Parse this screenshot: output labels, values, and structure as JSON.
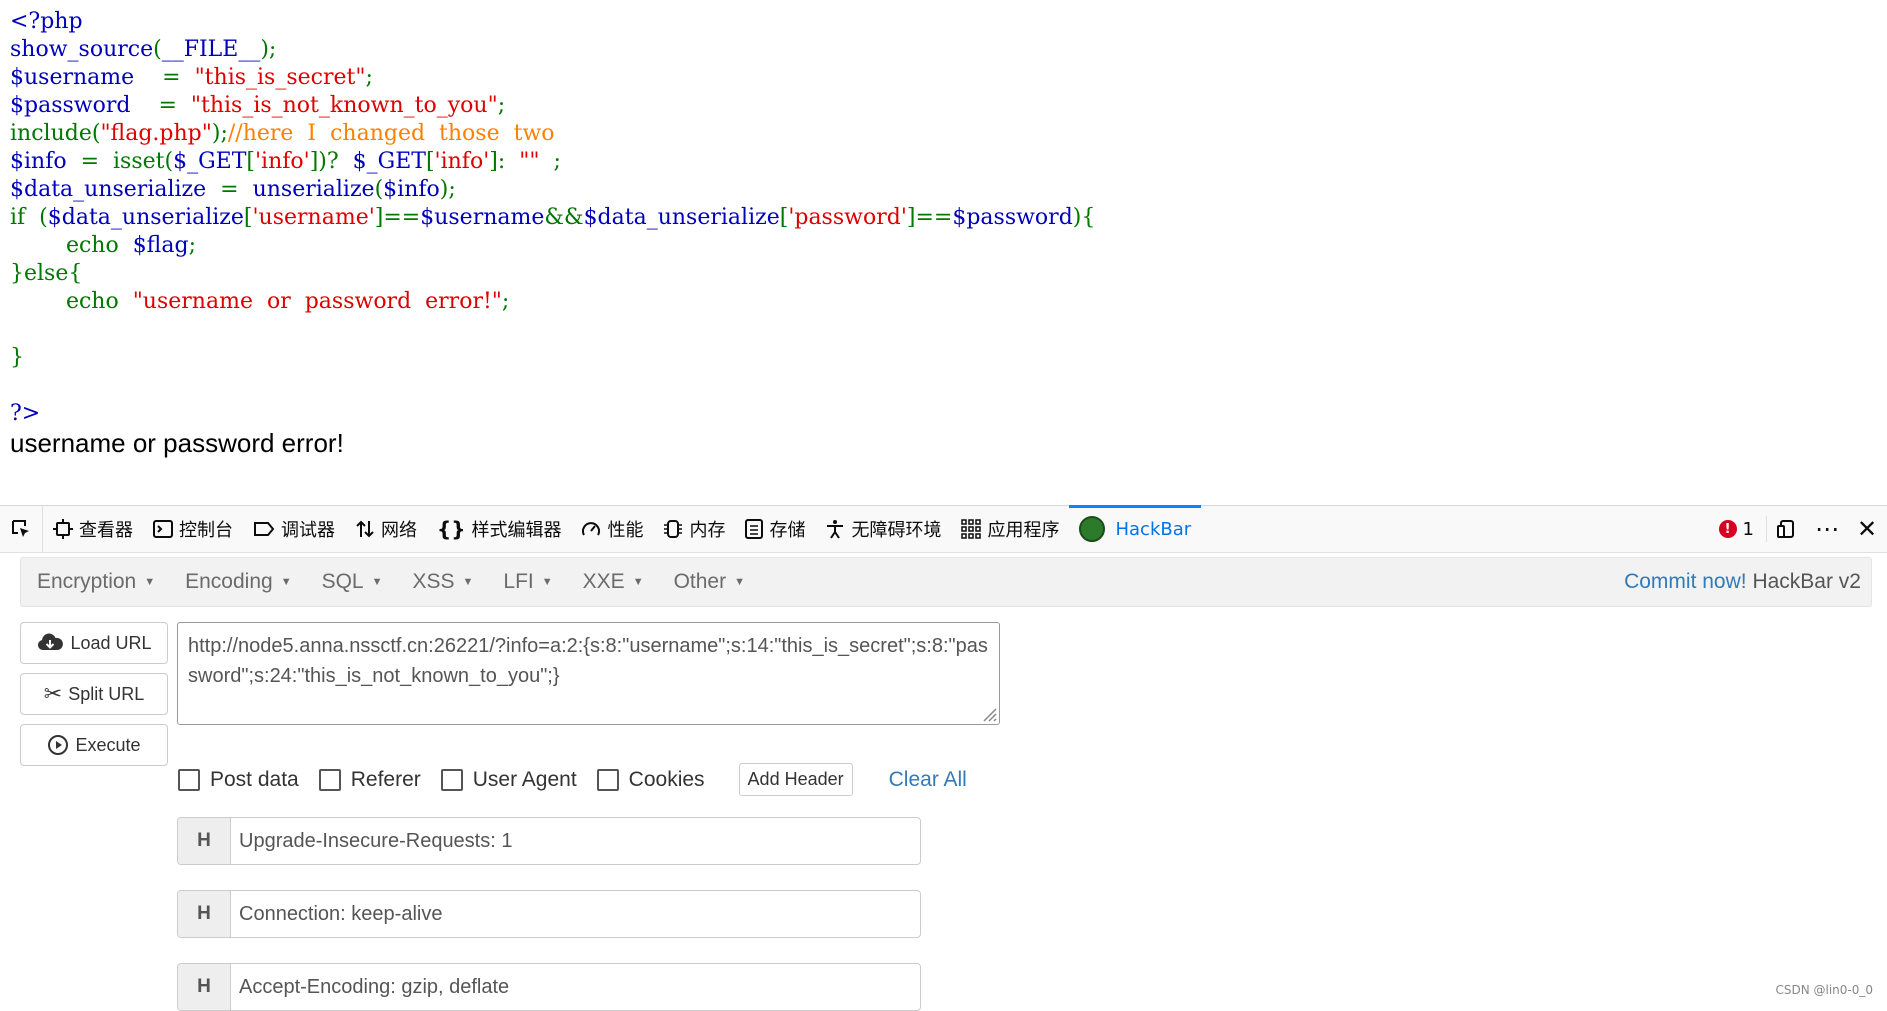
{
  "source_code": {
    "lines": [
      [
        {
          "t": "<?php",
          "c": "d"
        }
      ],
      [
        {
          "t": "show_source",
          "c": "d"
        },
        {
          "t": "(",
          "c": "g"
        },
        {
          "t": "__FILE__",
          "c": "d"
        },
        {
          "t": ");",
          "c": "g"
        }
      ],
      [
        {
          "t": "$username    ",
          "c": "d"
        },
        {
          "t": "=  ",
          "c": "g"
        },
        {
          "t": "\"this_is_secret\"",
          "c": "s"
        },
        {
          "t": ";",
          "c": "g"
        }
      ],
      [
        {
          "t": "$password    ",
          "c": "d"
        },
        {
          "t": "=  ",
          "c": "g"
        },
        {
          "t": "\"this_is_not_known_to_you\"",
          "c": "s"
        },
        {
          "t": ";",
          "c": "g"
        }
      ],
      [
        {
          "t": "include",
          "c": "g"
        },
        {
          "t": "(",
          "c": "g"
        },
        {
          "t": "\"flag.php\"",
          "c": "s"
        },
        {
          "t": ");",
          "c": "g"
        },
        {
          "t": "//here  I  changed  those  two",
          "c": "o"
        }
      ],
      [
        {
          "t": "$info  ",
          "c": "d"
        },
        {
          "t": "=  isset",
          "c": "g"
        },
        {
          "t": "(",
          "c": "g"
        },
        {
          "t": "$_GET",
          "c": "d"
        },
        {
          "t": "[",
          "c": "g"
        },
        {
          "t": "'info'",
          "c": "s"
        },
        {
          "t": "])?  ",
          "c": "g"
        },
        {
          "t": "$_GET",
          "c": "d"
        },
        {
          "t": "[",
          "c": "g"
        },
        {
          "t": "'info'",
          "c": "s"
        },
        {
          "t": "]:  ",
          "c": "g"
        },
        {
          "t": "\"\"",
          "c": "s"
        },
        {
          "t": "  ;",
          "c": "g"
        }
      ],
      [
        {
          "t": "$data_unserialize  ",
          "c": "d"
        },
        {
          "t": "=  ",
          "c": "g"
        },
        {
          "t": "unserialize",
          "c": "d"
        },
        {
          "t": "(",
          "c": "g"
        },
        {
          "t": "$info",
          "c": "d"
        },
        {
          "t": ");",
          "c": "g"
        }
      ],
      [
        {
          "t": "if  (",
          "c": "g"
        },
        {
          "t": "$data_unserialize",
          "c": "d"
        },
        {
          "t": "[",
          "c": "g"
        },
        {
          "t": "'username'",
          "c": "s"
        },
        {
          "t": "]==",
          "c": "g"
        },
        {
          "t": "$username",
          "c": "d"
        },
        {
          "t": "&&",
          "c": "g"
        },
        {
          "t": "$data_unserialize",
          "c": "d"
        },
        {
          "t": "[",
          "c": "g"
        },
        {
          "t": "'password'",
          "c": "s"
        },
        {
          "t": "]==",
          "c": "g"
        },
        {
          "t": "$password",
          "c": "d"
        },
        {
          "t": "){",
          "c": "g"
        }
      ],
      [
        {
          "t": "        echo  ",
          "c": "g"
        },
        {
          "t": "$flag",
          "c": "d"
        },
        {
          "t": ";",
          "c": "g"
        }
      ],
      [
        {
          "t": "}else{",
          "c": "g"
        }
      ],
      [
        {
          "t": "        echo  ",
          "c": "g"
        },
        {
          "t": "\"username  or  password  error!\"",
          "c": "s"
        },
        {
          "t": ";",
          "c": "g"
        }
      ],
      [
        {
          "t": "",
          "c": "g"
        }
      ],
      [
        {
          "t": "}",
          "c": "g"
        }
      ],
      [
        {
          "t": "",
          "c": "g"
        }
      ],
      [
        {
          "t": "?>",
          "c": "d"
        }
      ]
    ]
  },
  "page_output": "username or password error!",
  "devtools": {
    "tabs": [
      {
        "label": "查看器",
        "icon": "inspector-icon"
      },
      {
        "label": "控制台",
        "icon": "console-icon"
      },
      {
        "label": "调试器",
        "icon": "debugger-icon"
      },
      {
        "label": "网络",
        "icon": "network-icon"
      },
      {
        "label": "样式编辑器",
        "icon": "style-editor-icon"
      },
      {
        "label": "性能",
        "icon": "performance-icon"
      },
      {
        "label": "内存",
        "icon": "memory-icon"
      },
      {
        "label": "存储",
        "icon": "storage-icon"
      },
      {
        "label": "无障碍环境",
        "icon": "accessibility-icon"
      },
      {
        "label": "应用程序",
        "icon": "application-icon"
      }
    ],
    "active_tab": "HackBar",
    "error_count": "1"
  },
  "hackbar": {
    "menus": [
      "Encryption",
      "Encoding",
      "SQL",
      "XSS",
      "LFI",
      "XXE",
      "Other"
    ],
    "commit_link": "Commit now!",
    "version": "HackBar v2",
    "buttons": {
      "load": "Load URL",
      "split": "Split URL",
      "execute": "Execute"
    },
    "url_value": "http://node5.anna.nssctf.cn:26221/?info=a:2:{s:8:\"username\";s:14:\"this_is_secret\";s:8:\"password\";s:24:\"this_is_not_known_to_you\";}",
    "options": {
      "post_data": "Post data",
      "referer": "Referer",
      "user_agent": "User Agent",
      "cookies": "Cookies"
    },
    "add_header": "Add Header",
    "clear_all": "Clear All",
    "header_label": "H",
    "headers": [
      "Upgrade-Insecure-Requests: 1",
      "Connection: keep-alive",
      "Accept-Encoding: gzip, deflate"
    ]
  },
  "watermark": "CSDN @lin0-0_0",
  "colors": {
    "code_default": "#0000bb",
    "code_keyword": "#007700",
    "code_string": "#dd0000",
    "code_comment": "#ff8000",
    "link": "#337ab7",
    "active_tab": "#0074e8"
  }
}
